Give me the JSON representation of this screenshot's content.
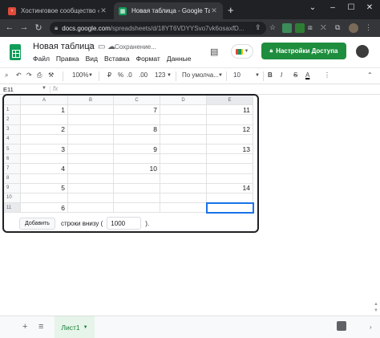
{
  "browser": {
    "tabs": [
      {
        "title": "Хостинговое сообщество «Time",
        "active": false
      },
      {
        "title": "Новая таблица - Google Табли",
        "active": true
      }
    ],
    "url_host": "docs.google.com",
    "url_path": "/spreadsheets/d/18YT6VDYYSvo7vk6osaxfD..."
  },
  "doc": {
    "title": "Новая таблица",
    "saving": "Сохранение...",
    "menus": [
      "Файл",
      "Правка",
      "Вид",
      "Вставка",
      "Формат",
      "Данные"
    ],
    "share_label": "Настройки Доступа"
  },
  "toolbar": {
    "zoom": "100%",
    "currency": "₽",
    "percent": "%",
    "dec_dec": ".0",
    "dec_inc": ".00",
    "more_formats": "123",
    "font": "По умолча...",
    "size": "10",
    "bold": "B",
    "italic": "I",
    "strike": "S",
    "text_color": "A"
  },
  "formula_bar": {
    "cell_ref": "E11",
    "fx": "fx"
  },
  "grid": {
    "columns": [
      "A",
      "B",
      "C",
      "D",
      "E"
    ],
    "selected_column": "E",
    "selected_row": 11,
    "rows": [
      {
        "n": "1",
        "cells": [
          "1",
          "",
          "7",
          "",
          "11"
        ]
      },
      {
        "n": "2",
        "cells": [
          "",
          "",
          "",
          "",
          ""
        ]
      },
      {
        "n": "3",
        "cells": [
          "2",
          "",
          "8",
          "",
          "12"
        ]
      },
      {
        "n": "4",
        "cells": [
          "",
          "",
          "",
          "",
          ""
        ]
      },
      {
        "n": "5",
        "cells": [
          "3",
          "",
          "9",
          "",
          "13"
        ]
      },
      {
        "n": "6",
        "cells": [
          "",
          "",
          "",
          "",
          ""
        ]
      },
      {
        "n": "7",
        "cells": [
          "4",
          "",
          "10",
          "",
          ""
        ]
      },
      {
        "n": "8",
        "cells": [
          "",
          "",
          "",
          "",
          ""
        ]
      },
      {
        "n": "9",
        "cells": [
          "5",
          "",
          "",
          "",
          "14"
        ]
      },
      {
        "n": "10",
        "cells": [
          "",
          "",
          "",
          "",
          ""
        ]
      },
      {
        "n": "11",
        "cells": [
          "6",
          "",
          "",
          "",
          ""
        ]
      }
    ]
  },
  "add_rows": {
    "button": "Добавить",
    "text": "строки внизу (",
    "value": "1000",
    "suffix": ")."
  },
  "sheet_bar": {
    "add": "+",
    "menu": "≡",
    "sheet_name": "Лист1"
  },
  "colors": {
    "brand_green": "#1e8e3e",
    "selection_blue": "#1a73e8",
    "chrome_dark": "#202124"
  }
}
